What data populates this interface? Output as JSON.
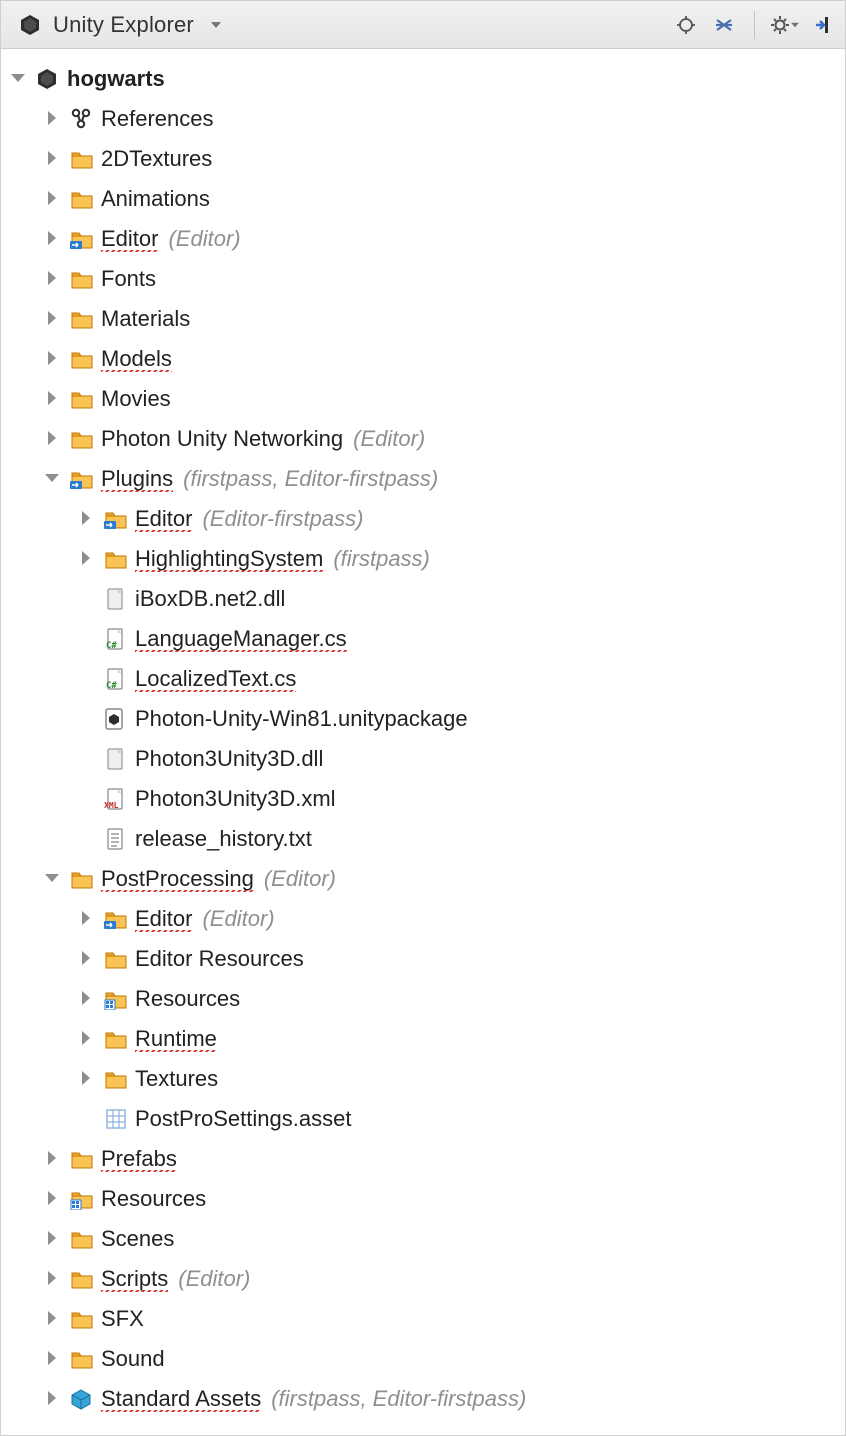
{
  "header": {
    "title": "Unity Explorer"
  },
  "project": {
    "name": "hogwarts"
  },
  "nodes": [
    {
      "id": "root",
      "lv": 0,
      "exp": "open",
      "icon": "unity",
      "label": "hogwarts",
      "bold": true
    },
    {
      "id": "refs",
      "lv": 1,
      "exp": "closed",
      "icon": "refs",
      "label": "References"
    },
    {
      "id": "2dtex",
      "lv": 1,
      "exp": "closed",
      "icon": "folder",
      "label": "2DTextures"
    },
    {
      "id": "anim",
      "lv": 1,
      "exp": "closed",
      "icon": "folder",
      "label": "Animations"
    },
    {
      "id": "editor",
      "lv": 1,
      "exp": "closed",
      "icon": "folder-sp",
      "label": "Editor",
      "spell": true,
      "note": "(Editor)"
    },
    {
      "id": "fonts",
      "lv": 1,
      "exp": "closed",
      "icon": "folder",
      "label": "Fonts"
    },
    {
      "id": "mats",
      "lv": 1,
      "exp": "closed",
      "icon": "folder",
      "label": "Materials"
    },
    {
      "id": "models",
      "lv": 1,
      "exp": "closed",
      "icon": "folder",
      "label": "Models",
      "spell": true
    },
    {
      "id": "movies",
      "lv": 1,
      "exp": "closed",
      "icon": "folder",
      "label": "Movies"
    },
    {
      "id": "photon",
      "lv": 1,
      "exp": "closed",
      "icon": "folder",
      "label": "Photon Unity Networking",
      "note": "(Editor)"
    },
    {
      "id": "plugins",
      "lv": 1,
      "exp": "open",
      "icon": "folder-sp",
      "label": "Plugins",
      "spell": true,
      "note": "(firstpass, Editor-firstpass)"
    },
    {
      "id": "plugins-editor",
      "lv": 2,
      "exp": "closed",
      "icon": "folder-sp",
      "label": "Editor",
      "spell": true,
      "note": "(Editor-firstpass)"
    },
    {
      "id": "plugins-hl",
      "lv": 2,
      "exp": "closed",
      "icon": "folder",
      "label": "HighlightingSystem",
      "spell": true,
      "note": "(firstpass)"
    },
    {
      "id": "ibox",
      "lv": 2,
      "exp": "none",
      "icon": "bin",
      "label": "iBoxDB.net2.dll"
    },
    {
      "id": "lang",
      "lv": 2,
      "exp": "none",
      "icon": "cs",
      "label": "LanguageManager.cs",
      "spell": true
    },
    {
      "id": "loctxt",
      "lv": 2,
      "exp": "none",
      "icon": "cs",
      "label": "LocalizedText.cs",
      "spell": true
    },
    {
      "id": "upkg",
      "lv": 2,
      "exp": "none",
      "icon": "unity-sm",
      "label": "Photon-Unity-Win81.unitypackage"
    },
    {
      "id": "p3dll",
      "lv": 2,
      "exp": "none",
      "icon": "bin",
      "label": "Photon3Unity3D.dll"
    },
    {
      "id": "p3xml",
      "lv": 2,
      "exp": "none",
      "icon": "xml",
      "label": "Photon3Unity3D.xml"
    },
    {
      "id": "relh",
      "lv": 2,
      "exp": "none",
      "icon": "txt",
      "label": "release_history.txt"
    },
    {
      "id": "pp",
      "lv": 1,
      "exp": "open",
      "icon": "folder",
      "label": "PostProcessing",
      "spell": true,
      "note": "(Editor)"
    },
    {
      "id": "pp-ed",
      "lv": 2,
      "exp": "closed",
      "icon": "folder-sp",
      "label": "Editor",
      "spell": true,
      "note": "(Editor)"
    },
    {
      "id": "pp-edres",
      "lv": 2,
      "exp": "closed",
      "icon": "folder",
      "label": "Editor Resources"
    },
    {
      "id": "pp-res",
      "lv": 2,
      "exp": "closed",
      "icon": "folder-res",
      "label": "Resources"
    },
    {
      "id": "pp-rt",
      "lv": 2,
      "exp": "closed",
      "icon": "folder",
      "label": "Runtime",
      "spell": true
    },
    {
      "id": "pp-tex",
      "lv": 2,
      "exp": "closed",
      "icon": "folder",
      "label": "Textures"
    },
    {
      "id": "pp-set",
      "lv": 2,
      "exp": "none",
      "icon": "asset",
      "label": "PostProSettings.asset"
    },
    {
      "id": "prefabs",
      "lv": 1,
      "exp": "closed",
      "icon": "folder",
      "label": "Prefabs",
      "spell": true
    },
    {
      "id": "res",
      "lv": 1,
      "exp": "closed",
      "icon": "folder-res",
      "label": "Resources"
    },
    {
      "id": "scenes",
      "lv": 1,
      "exp": "closed",
      "icon": "folder",
      "label": "Scenes"
    },
    {
      "id": "scripts",
      "lv": 1,
      "exp": "closed",
      "icon": "folder",
      "label": "Scripts",
      "spell": true,
      "note": "(Editor)"
    },
    {
      "id": "sfx",
      "lv": 1,
      "exp": "closed",
      "icon": "folder",
      "label": "SFX"
    },
    {
      "id": "sound",
      "lv": 1,
      "exp": "closed",
      "icon": "folder",
      "label": "Sound"
    },
    {
      "id": "stdassets",
      "lv": 1,
      "exp": "closed",
      "icon": "pkg",
      "label": "Standard Assets",
      "spell": true,
      "note": "(firstpass, Editor-firstpass)"
    }
  ]
}
